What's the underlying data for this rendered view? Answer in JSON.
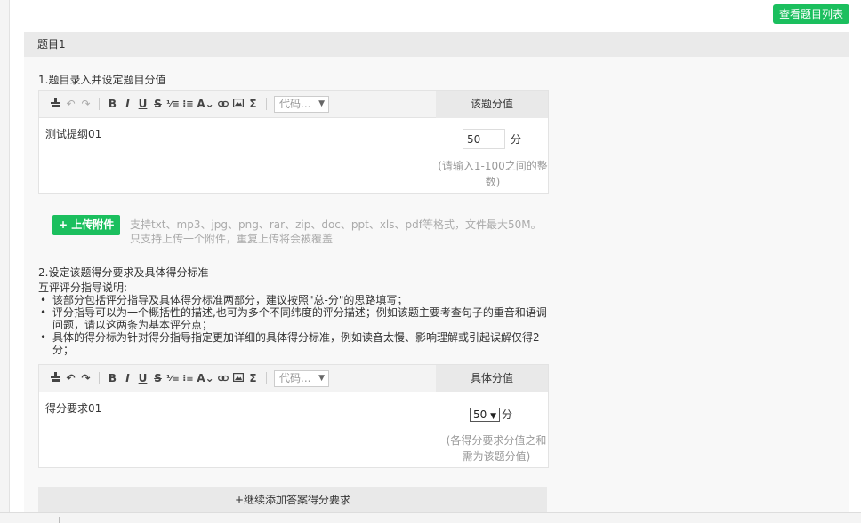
{
  "top_button": "查看题目列表",
  "question_title": "题目1",
  "section1": {
    "title": "1.题目录入并设定题目分值",
    "code_select": "代码...",
    "score_header": "该题分值",
    "content": "测试提纲01",
    "score_value": "50",
    "score_unit": "分",
    "score_hint": "(请输入1-100之间的整数)"
  },
  "upload": {
    "button": "+ 上传附件",
    "hint_line1": "支持txt、mp3、jpg、png、rar、zip、doc、ppt、xls、pdf等格式，文件最大50M。",
    "hint_line2": "只支持上传一个附件，重复上传将会被覆盖"
  },
  "section2": {
    "title": "2.设定该题得分要求及具体得分标准",
    "guide_title": "互评评分指导说明:",
    "guide_items": [
      "该部分包括评分指导及具体得分标准两部分，建议按照\"总-分\"的思路填写；",
      "评分指导可以为一个概括性的描述,也可为多个不同纬度的评分描述；例如该题主要考查句子的重音和语调问题，请以这两条为基本评分点；",
      "具体的得分标为针对得分指导指定更加详细的具体得分标准，例如读音太慢、影响理解或引起误解仅得2分；"
    ],
    "code_select": "代码...",
    "score_header": "具体分值",
    "content": "得分要求01",
    "score_value": "50",
    "score_unit": "分",
    "score_hint": "(各得分要求分值之和需为该题分值)",
    "add_button": "+继续添加答案得分要求"
  }
}
